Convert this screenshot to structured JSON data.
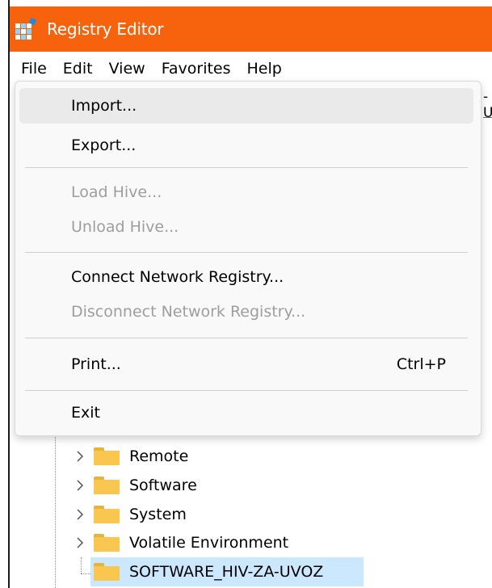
{
  "window": {
    "title": "Registry Editor",
    "title_bar_color": "#f7630c",
    "icon": "registry-grid-icon"
  },
  "menubar": {
    "items": [
      "File",
      "Edit",
      "View",
      "Favorites",
      "Help"
    ]
  },
  "background_pane_text": "-U",
  "file_menu": {
    "items": [
      {
        "label": "Import...",
        "enabled": true,
        "highlighted": true
      },
      {
        "label": "Export...",
        "enabled": true
      },
      {
        "label": "Load Hive...",
        "enabled": false
      },
      {
        "label": "Unload Hive...",
        "enabled": false
      },
      {
        "label": "Connect Network Registry...",
        "enabled": true
      },
      {
        "label": "Disconnect Network Registry...",
        "enabled": false
      },
      {
        "label": "Print...",
        "enabled": true,
        "shortcut": "Ctrl+P"
      },
      {
        "label": "Exit",
        "enabled": true
      }
    ]
  },
  "tree": {
    "items": [
      {
        "label": "Remote",
        "expandable": true,
        "icon": "folder-icon"
      },
      {
        "label": "Software",
        "expandable": true,
        "icon": "folder-icon"
      },
      {
        "label": "System",
        "expandable": true,
        "icon": "folder-icon"
      },
      {
        "label": "Volatile Environment",
        "expandable": true,
        "icon": "folder-icon"
      },
      {
        "label": "SOFTWARE_HIV-ZA-UVOZ",
        "expandable": false,
        "selected": true,
        "icon": "folder-icon"
      }
    ],
    "selected_color": "#cce8ff",
    "folder_color": "#f9c74f"
  }
}
